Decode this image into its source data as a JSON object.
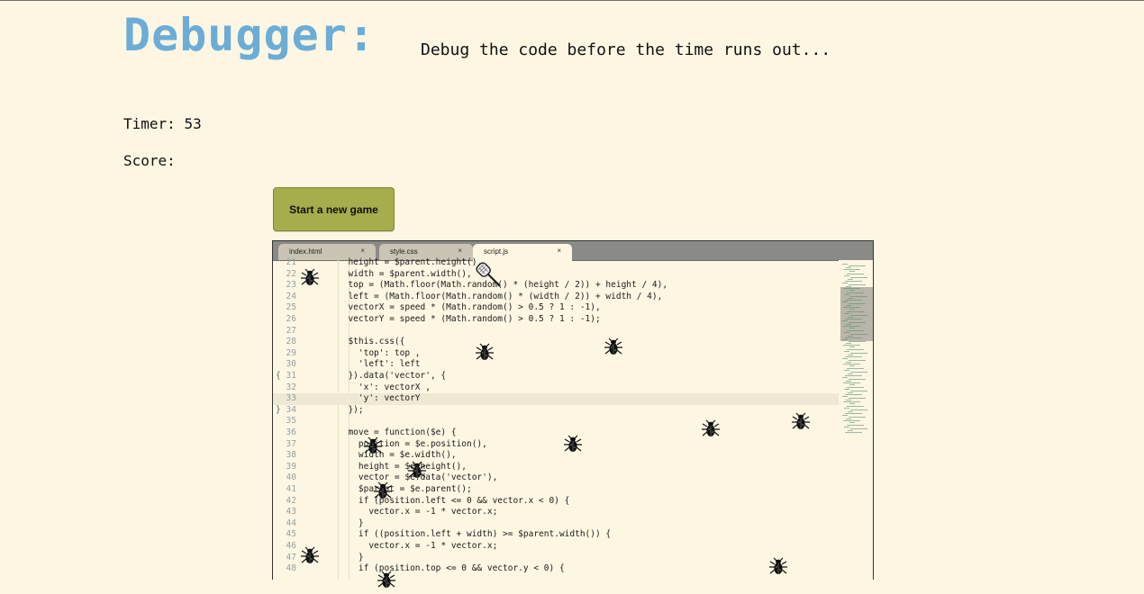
{
  "header": {
    "title": "Debugger:",
    "subtitle": "Debug the code before the time runs out..."
  },
  "stats": {
    "timer_label": "Timer:",
    "timer_value": "53",
    "score_label": "Score:",
    "score_value": ""
  },
  "start_button": {
    "label": "Start a new game"
  },
  "editor": {
    "tabs": [
      {
        "name": "index.html",
        "close": "×",
        "active": false
      },
      {
        "name": "style.css",
        "close": "×",
        "active": false
      },
      {
        "name": "script.js",
        "close": "×",
        "active": true
      }
    ],
    "lines": [
      {
        "n": "21",
        "fold": "",
        "text": "  height = $parent.height(),"
      },
      {
        "n": "22",
        "fold": "",
        "text": "  width = $parent.width(),"
      },
      {
        "n": "23",
        "fold": "",
        "text": "  top = (Math.floor(Math.random() * (height / 2)) + height / 4),"
      },
      {
        "n": "24",
        "fold": "",
        "text": "  left = (Math.floor(Math.random() * (width / 2)) + width / 4),"
      },
      {
        "n": "25",
        "fold": "",
        "text": "  vectorX = speed * (Math.random() > 0.5 ? 1 : -1),"
      },
      {
        "n": "26",
        "fold": "",
        "text": "  vectorY = speed * (Math.random() > 0.5 ? 1 : -1);"
      },
      {
        "n": "27",
        "fold": "",
        "text": ""
      },
      {
        "n": "28",
        "fold": "",
        "text": "  $this.css({"
      },
      {
        "n": "29",
        "fold": "",
        "text": "    'top': top ,"
      },
      {
        "n": "30",
        "fold": "",
        "text": "    'left': left"
      },
      {
        "n": "31",
        "fold": "{",
        "text": "  }).data('vector', {"
      },
      {
        "n": "32",
        "fold": "",
        "text": "    'x': vectorX ,"
      },
      {
        "n": "33",
        "fold": "",
        "text": "    'y': vectorY"
      },
      {
        "n": "34",
        "fold": "}",
        "text": "  });"
      },
      {
        "n": "35",
        "fold": "",
        "text": ""
      },
      {
        "n": "36",
        "fold": "",
        "text": "  move = function($e) {"
      },
      {
        "n": "37",
        "fold": "",
        "text": "    position = $e.position(),"
      },
      {
        "n": "38",
        "fold": "",
        "text": "    width = $e.width(),"
      },
      {
        "n": "39",
        "fold": "",
        "text": "    height = $e.height(),"
      },
      {
        "n": "40",
        "fold": "",
        "text": "    vector = $e.data('vector'),"
      },
      {
        "n": "41",
        "fold": "",
        "text": "    $parent = $e.parent();"
      },
      {
        "n": "42",
        "fold": "",
        "text": "    if (position.left <= 0 && vector.x < 0) {"
      },
      {
        "n": "43",
        "fold": "",
        "text": "      vector.x = -1 * vector.x;"
      },
      {
        "n": "44",
        "fold": "",
        "text": "    }"
      },
      {
        "n": "45",
        "fold": "",
        "text": "    if ((position.left + width) >= $parent.width()) {"
      },
      {
        "n": "46",
        "fold": "",
        "text": "      vector.x = -1 * vector.x;"
      },
      {
        "n": "47",
        "fold": "",
        "text": "    }"
      },
      {
        "n": "48",
        "fold": "",
        "text": "    if (position.top <= 0 && vector.y < 0) {"
      }
    ],
    "highlighted_line": "33"
  },
  "bugs_visible": 14,
  "colors": {
    "background": "#fdf6e3",
    "title": "#6badd6",
    "button": "#a5ad4c",
    "bug": "#111111"
  }
}
